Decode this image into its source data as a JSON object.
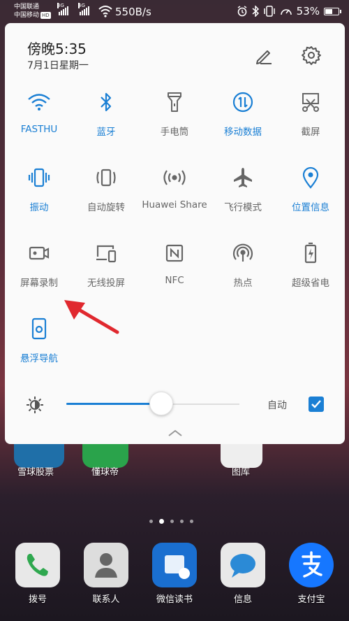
{
  "status_bar": {
    "carrier1": "中国联通",
    "carrier2": "中国移动",
    "hd_badge": "HD",
    "net1": "3G",
    "net2": "4G",
    "speed": "550B/s",
    "battery": "53%"
  },
  "panel": {
    "time": "傍晚5:35",
    "date": "7月1日星期一",
    "tiles": [
      {
        "label": "FASTHU",
        "icon": "wifi-icon",
        "on": true
      },
      {
        "label": "蓝牙",
        "icon": "bluetooth-icon",
        "on": true
      },
      {
        "label": "手电筒",
        "icon": "flashlight-icon",
        "on": false
      },
      {
        "label": "移动数据",
        "icon": "mobile-data-icon",
        "on": true
      },
      {
        "label": "截屏",
        "icon": "screenshot-icon",
        "on": false
      },
      {
        "label": "振动",
        "icon": "vibrate-icon",
        "on": true
      },
      {
        "label": "自动旋转",
        "icon": "rotate-icon",
        "on": false
      },
      {
        "label": "Huawei Share",
        "icon": "huawei-share-icon",
        "on": false
      },
      {
        "label": "飞行模式",
        "icon": "airplane-icon",
        "on": false
      },
      {
        "label": "位置信息",
        "icon": "location-icon",
        "on": true
      },
      {
        "label": "屏幕录制",
        "icon": "screen-record-icon",
        "on": false
      },
      {
        "label": "无线投屏",
        "icon": "wireless-projection-icon",
        "on": false
      },
      {
        "label": "NFC",
        "icon": "nfc-icon",
        "on": false
      },
      {
        "label": "热点",
        "icon": "hotspot-icon",
        "on": false
      },
      {
        "label": "超级省电",
        "icon": "power-saving-icon",
        "on": false
      },
      {
        "label": "悬浮导航",
        "icon": "floating-nav-icon",
        "on": true
      }
    ],
    "brightness": {
      "level": 0.55,
      "auto_label": "自动",
      "auto_checked": true
    }
  },
  "home": {
    "partial_apps": [
      "雪球股票",
      "懂球帝",
      "图库"
    ],
    "dock": [
      "拨号",
      "联系人",
      "微信读书",
      "信息",
      "支付宝"
    ]
  },
  "colors": {
    "accent": "#1a7fd4",
    "inactive": "#666666",
    "arrow": "#e0282e"
  }
}
